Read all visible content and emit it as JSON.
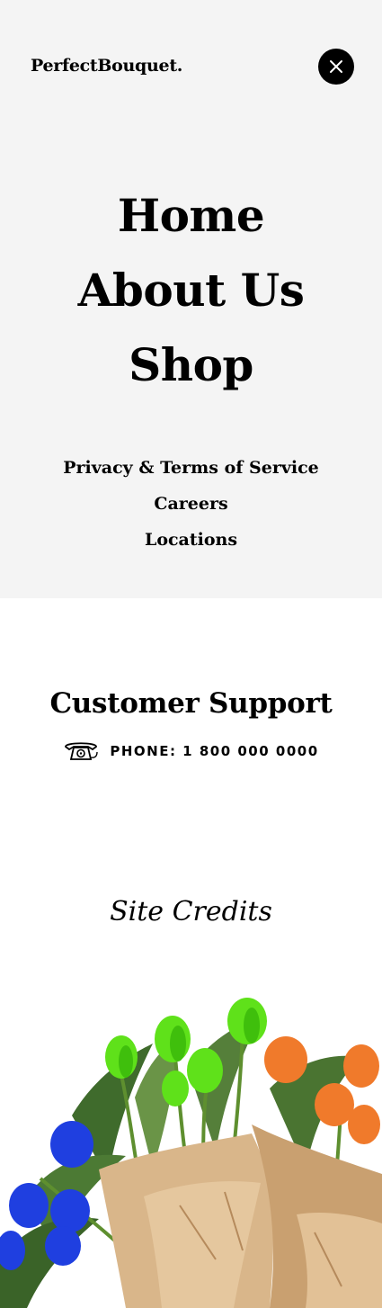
{
  "brand": {
    "logo": "PerfectBouquet."
  },
  "primary_nav": {
    "home": "Home",
    "about": "About Us",
    "shop": "Shop"
  },
  "secondary_nav": {
    "privacy": "Privacy & Terms of Service",
    "careers": "Careers",
    "locations": "Locations"
  },
  "support": {
    "title": "Customer Support",
    "phone": "PHONE: 1 800 000 0000",
    "icon": "telephone-icon"
  },
  "credits": {
    "label": "Site Credits"
  },
  "icons": {
    "close": "close-icon"
  },
  "colors": {
    "menu_bg": "#f4f4f4",
    "page_bg": "#ffffff",
    "text": "#000000",
    "close_bg": "#000000"
  }
}
